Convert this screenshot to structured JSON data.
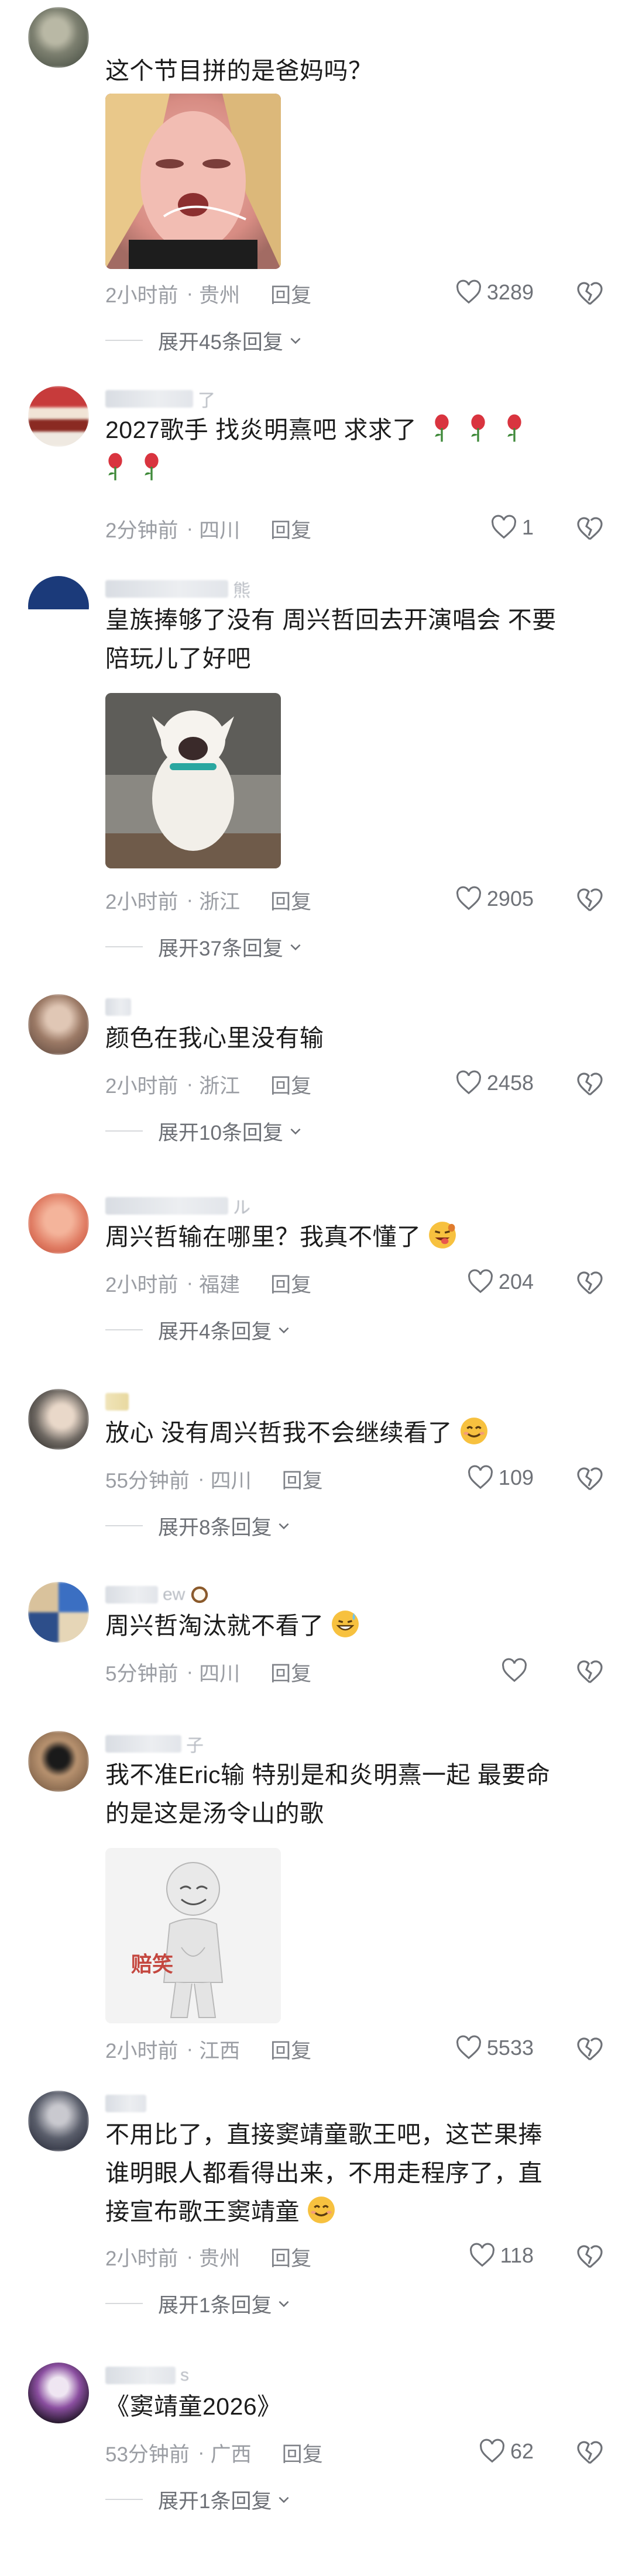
{
  "comments": [
    {
      "id": "c1",
      "username_tail": "",
      "text_lines": [
        "这个节目拼的是爸妈吗？"
      ],
      "time": "2小时前",
      "location": "贵州",
      "reply_label": "回复",
      "likes": "3289",
      "expand_label": "展开45条回复"
    },
    {
      "id": "c2",
      "username_tail": "了",
      "text_lines": [
        "2027歌手  找炎明熹吧 求求了"
      ],
      "time": "2分钟前",
      "location": "四川",
      "reply_label": "回复",
      "likes": "1",
      "expand_label": ""
    },
    {
      "id": "c3",
      "username_tail": "熊",
      "text_lines": [
        "皇族捧够了没有 周兴哲回去开演唱会 不要",
        "陪玩儿了好吧"
      ],
      "time": "2小时前",
      "location": "浙江",
      "reply_label": "回复",
      "likes": "2905",
      "expand_label": "展开37条回复"
    },
    {
      "id": "c4",
      "username_tail": "",
      "text_lines": [
        "颜色在我心里没有输"
      ],
      "time": "2小时前",
      "location": "浙江",
      "reply_label": "回复",
      "likes": "2458",
      "expand_label": "展开10条回复"
    },
    {
      "id": "c5",
      "username_tail": "ル",
      "text_lines": [
        "周兴哲输在哪里？我真不懂了"
      ],
      "time": "2小时前",
      "location": "福建",
      "reply_label": "回复",
      "likes": "204",
      "expand_label": "展开4条回复"
    },
    {
      "id": "c6",
      "username_tail": "",
      "text_lines": [
        "放心  没有周兴哲我不会继续看了"
      ],
      "time": "55分钟前",
      "location": "四川",
      "reply_label": "回复",
      "likes": "109",
      "expand_label": "展开8条回复"
    },
    {
      "id": "c7",
      "username_tail": "ew",
      "text_lines": [
        "周兴哲淘汰就不看了"
      ],
      "time": "5分钟前",
      "location": "四川",
      "reply_label": "回复",
      "likes": "",
      "expand_label": ""
    },
    {
      "id": "c8",
      "username_tail": "子",
      "text_lines": [
        "我不准Eric输 特别是和炎明熹一起 最要命",
        "的是这是汤令山的歌"
      ],
      "image_caption": "赔笑",
      "time": "2小时前",
      "location": "江西",
      "reply_label": "回复",
      "likes": "5533",
      "expand_label": ""
    },
    {
      "id": "c9",
      "username_tail": "",
      "text_lines": [
        "不用比了，直接窦靖童歌王吧，这芒果捧",
        "谁明眼人都看得出来，不用走程序了，直",
        "接宣布歌王窦靖童"
      ],
      "time": "2小时前",
      "location": "贵州",
      "reply_label": "回复",
      "likes": "118",
      "expand_label": "展开1条回复"
    },
    {
      "id": "c10",
      "username_tail": "s",
      "text_lines": [
        "《窦靖童2026》"
      ],
      "time": "53分钟前",
      "location": "广西",
      "reply_label": "回复",
      "likes": "62",
      "expand_label": "展开1条回复"
    }
  ],
  "icons": {
    "like": "heart-outline-icon",
    "dislike": "broken-heart-icon",
    "expand": "chevron-down-icon"
  },
  "colors": {
    "text": "#1c1c1c",
    "meta": "#9a9da3",
    "rose": "#d9343f"
  }
}
